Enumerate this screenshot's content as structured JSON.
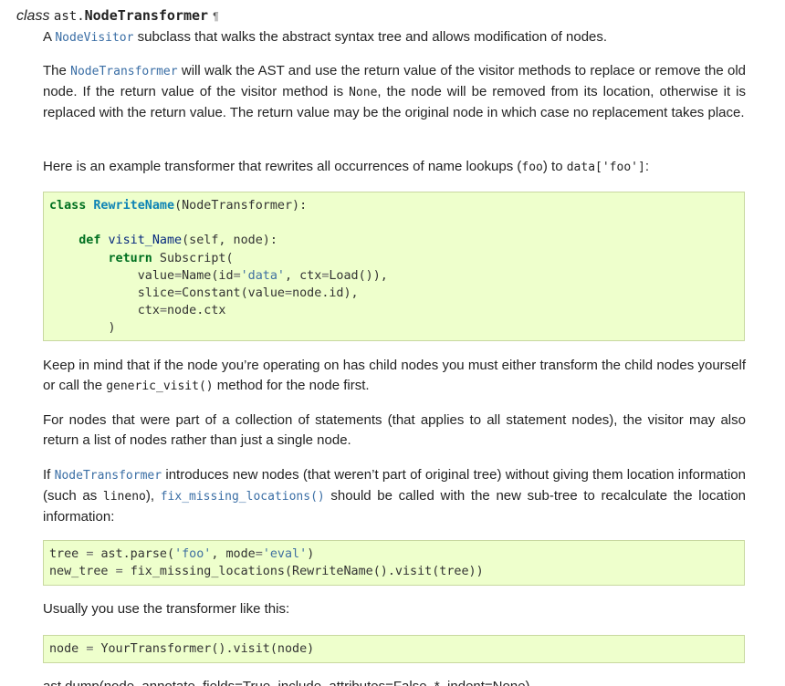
{
  "signature": {
    "keyword": "class",
    "module": "ast.",
    "name": "NodeTransformer",
    "pilcrow": "¶"
  },
  "p1": {
    "pre": "A ",
    "ref": "NodeVisitor",
    "post": " subclass that walks the abstract syntax tree and allows modification of nodes."
  },
  "p2": {
    "pre": "The ",
    "ref": "NodeTransformer",
    "mid": " will walk the AST and use the return value of the visitor methods to replace or remove the old node. If the return value of the visitor method is ",
    "lit": "None",
    "post": ", the node will be removed from its location, otherwise it is replaced with the return value. The return value may be the original node in which case no replacement takes place."
  },
  "p3": {
    "pre": "Here is an example transformer that rewrites all occurrences of name lookups (",
    "lit1": "foo",
    "mid": ") to ",
    "lit2": "data['foo']",
    "post": ":"
  },
  "code1": {
    "l1_kw": "class",
    "l1_cls": "RewriteName",
    "l1_rest": "(NodeTransformer):",
    "l3_kw": "def",
    "l3_fn": "visit_Name",
    "l3_rest": "(self, node):",
    "l4_kw": "return",
    "l4_rest": " Subscript(",
    "l5_a": "value",
    "l5_b": "Name(id",
    "l5_s": "'data'",
    "l5_c": ", ctx",
    "l5_d": "Load()),",
    "l6_a": "slice",
    "l6_b": "Constant(value",
    "l6_c": "node",
    "l6_d": ".id),",
    "l7_a": "ctx",
    "l7_b": "node",
    "l7_c": ".ctx",
    "l8": ")"
  },
  "p4": {
    "pre": "Keep in mind that if the node you’re operating on has child nodes you must either transform the child nodes yourself or call the ",
    "lit": "generic_visit()",
    "post": " method for the node first."
  },
  "p5": {
    "text": "For nodes that were part of a collection of statements (that applies to all statement nodes), the visitor may also return a list of nodes rather than just a single node."
  },
  "p6": {
    "pre": "If ",
    "ref1": "NodeTransformer",
    "mid1": " introduces new nodes (that weren’t part of original tree) without giving them location information (such as ",
    "lit": "lineno",
    "mid2": "), ",
    "ref2": "fix_missing_locations()",
    "post": " should be called with the new sub-tree to recalculate the location information:"
  },
  "code2": {
    "l1_a": "tree",
    "l1_b": "ast",
    "l1_c": ".parse(",
    "l1_s1": "'foo'",
    "l1_d": ", mode",
    "l1_s2": "'eval'",
    "l1_e": ")",
    "l2_a": "new_tree",
    "l2_b": "fix_missing_locations(RewriteName()",
    "l2_c": ".visit(tree))"
  },
  "p7": {
    "text": "Usually you use the transformer like this:"
  },
  "code3": {
    "a": "node",
    "b": "YourTransformer()",
    "c": ".visit(node)"
  },
  "cut_line": {
    "text": "ast.dump(node, annotate_fields=True, include_attributes=False, *, indent=None)"
  }
}
